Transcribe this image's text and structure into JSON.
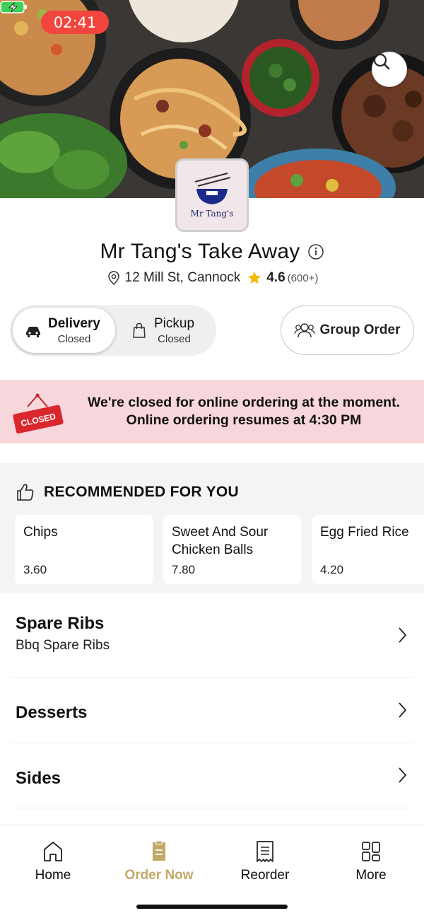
{
  "status_bar": {
    "time": "02:41"
  },
  "restaurant": {
    "logo_text": "Mr Tang's",
    "name": "Mr Tang's Take Away",
    "address": "12 Mill St, Cannock",
    "rating": "4.6",
    "rating_count": "(600+)"
  },
  "order_mode": {
    "delivery": {
      "label": "Delivery",
      "status": "Closed"
    },
    "pickup": {
      "label": "Pickup",
      "status": "Closed"
    },
    "selected": "delivery"
  },
  "group_order": {
    "label": "Group Order"
  },
  "closed_banner": {
    "sign_text": "CLOSED",
    "line1": "We're closed for online ordering at the moment.",
    "line2": "Online ordering resumes at 4:30 PM"
  },
  "recommended": {
    "title": "RECOMMENDED FOR YOU",
    "items": [
      {
        "name": "Chips",
        "price": "3.60"
      },
      {
        "name": "Sweet And Sour Chicken Balls",
        "price": "7.80"
      },
      {
        "name": "Egg Fried Rice",
        "price": "4.20"
      }
    ]
  },
  "categories": [
    {
      "name": "Spare Ribs",
      "subtitle": "Bbq Spare Ribs"
    },
    {
      "name": "Desserts",
      "subtitle": ""
    },
    {
      "name": "Sides",
      "subtitle": ""
    }
  ],
  "bottom_nav": {
    "items": [
      {
        "label": "Home",
        "icon": "home-icon"
      },
      {
        "label": "Order Now",
        "icon": "order-icon"
      },
      {
        "label": "Reorder",
        "icon": "receipt-icon"
      },
      {
        "label": "More",
        "icon": "grid-icon"
      }
    ],
    "active": "Order Now"
  },
  "colors": {
    "accent_gold": "#c2a968",
    "closed_banner_bg": "#f8d7dc",
    "status_red": "#f2453d",
    "star": "#f5b800"
  }
}
